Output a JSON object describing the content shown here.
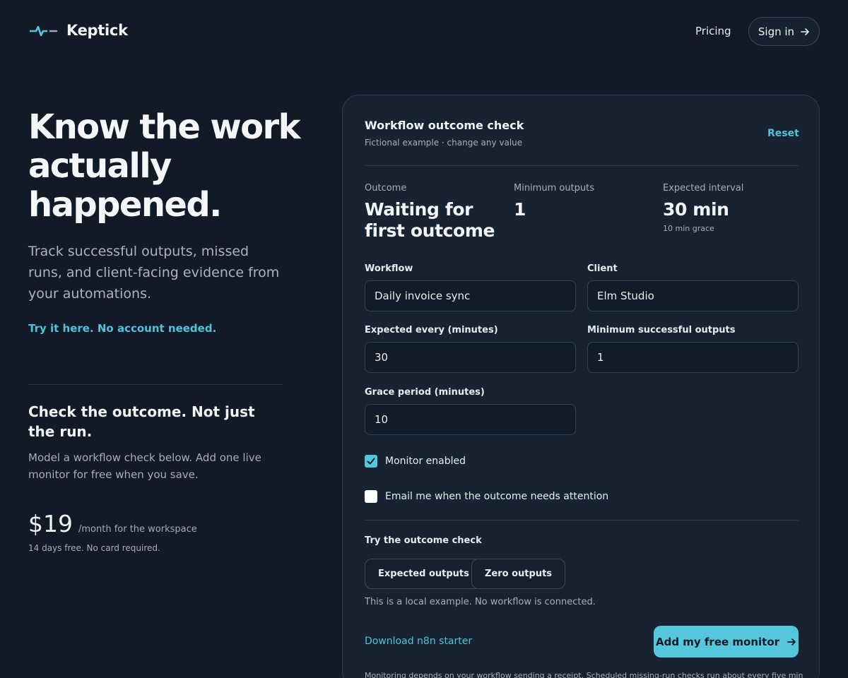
{
  "brand": {
    "name": "Keptick",
    "icon": "pulse-logo-icon",
    "accent": "#55c7dc"
  },
  "nav": {
    "pricing": "Pricing",
    "signin": "Sign in"
  },
  "hero": {
    "title": "Know the work actually happened.",
    "subtitle": "Track successful outputs, missed runs, and client-facing evidence from your automations.",
    "cta_link": "Try it here. No account needed."
  },
  "section": {
    "title": "Check the outcome. Not just the run.",
    "text": "Model a workflow check below. Add one live monitor for free when you save."
  },
  "pricing": {
    "amount": "$19",
    "unit": "/month for the workspace",
    "note": "14 days free. No card required."
  },
  "card": {
    "title": "Workflow outcome check",
    "subtitle": "Fictional example · change any value",
    "reset": "Reset",
    "stats": {
      "outcome": {
        "label": "Outcome",
        "value": "Waiting for first outcome"
      },
      "minimum": {
        "label": "Minimum outputs",
        "value": "1"
      },
      "interval": {
        "label": "Expected interval",
        "value": "30 min",
        "note": "10 min grace"
      }
    },
    "fields": {
      "workflow": {
        "label": "Workflow",
        "value": "Daily invoice sync"
      },
      "client": {
        "label": "Client",
        "value": "Elm Studio"
      },
      "expected_every": {
        "label": "Expected every (minutes)",
        "value": "30"
      },
      "min_success": {
        "label": "Minimum successful outputs",
        "value": "1"
      },
      "grace": {
        "label": "Grace period (minutes)",
        "value": "10"
      }
    },
    "checkboxes": {
      "monitor_enabled": {
        "label": "Monitor enabled",
        "checked": true
      },
      "email_me": {
        "label": "Email me when the outcome needs attention",
        "checked": false
      }
    },
    "try": {
      "label": "Try the outcome check",
      "buttons": [
        "Expected outputs",
        "Zero outputs"
      ],
      "note": "This is a local example. No workflow is connected."
    },
    "download": "Download n8n starter",
    "primary": "Add my free monitor",
    "fine_print": "Monitoring depends on your workflow sending a receipt. Scheduled missing-run checks run about every five minutes;"
  }
}
